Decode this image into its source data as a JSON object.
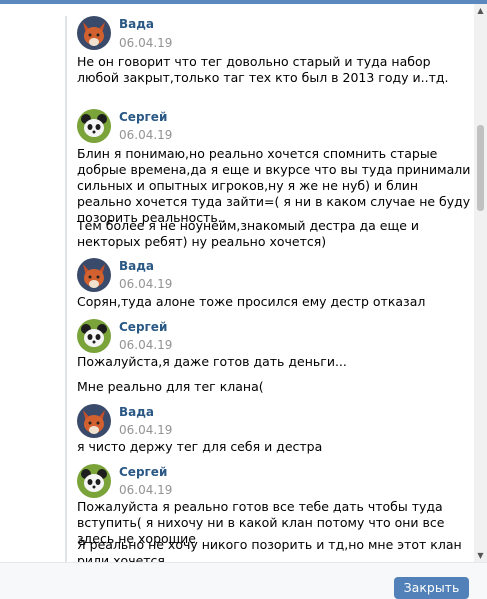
{
  "messages": [
    {
      "author": "Вада",
      "date": "06.04.19",
      "avatar": "fox-avatar",
      "paragraphs": [
        "Не он говорит что тег довольно старый и туда набор любой закрыт,только таг тех кто был в 2013 году и..тд."
      ]
    },
    {
      "author": "Сергей",
      "date": "06.04.19",
      "avatar": "panda-avatar",
      "paragraphs": [
        "Блин я понимаю,но реально хочется спомнить старые добрые времена,да я еще и вкурсе что вы туда принимали сильных и опытных игроков,ну я же не нуб) и блин реально хочется туда зайти=( я ни в каком случае не буду позорить реальность..",
        "Тем более я не ноунейм,знакомый дестра да еще и некторых ребят) ну реально хочется)"
      ]
    },
    {
      "author": "Вада",
      "date": "06.04.19",
      "avatar": "fox-avatar",
      "paragraphs": [
        "Сорян,туда алоне тоже просился ему дестр отказал"
      ]
    },
    {
      "author": "Сергей",
      "date": "06.04.19",
      "avatar": "panda-avatar",
      "paragraphs": [
        "Пожалуйста,я даже готов дать деньги...",
        "Мне реально для тег клана("
      ]
    },
    {
      "author": "Вада",
      "date": "06.04.19",
      "avatar": "fox-avatar",
      "paragraphs": [
        "я чисто держу тег для себя и дестра"
      ]
    },
    {
      "author": "Сергей",
      "date": "06.04.19",
      "avatar": "panda-avatar",
      "paragraphs": [
        "Пожалуйста я реально готов все тебе дать чтобы туда вступить( я нихочу ни в какой клан потому что они все здесь не хорошие",
        "Я реально не хочу никого позорить и тд,но мне этот клан рили хочется"
      ]
    }
  ],
  "footer": {
    "join_label": "Закрыть"
  },
  "icons": {
    "scroll_up": "arrow-up-icon",
    "scroll_down": "arrow-down-icon"
  },
  "colors": {
    "author": "#2a5885",
    "button": "#5181b8",
    "date": "#939393"
  }
}
